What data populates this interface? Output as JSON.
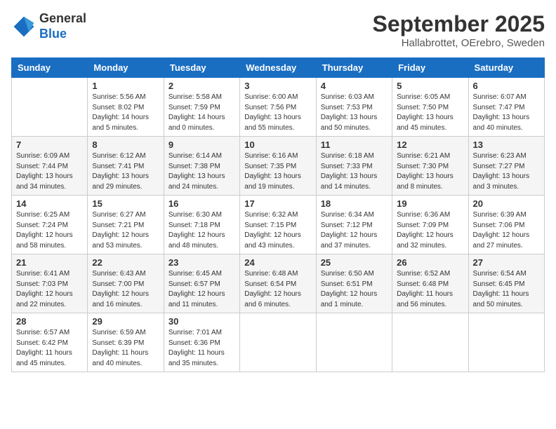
{
  "logo": {
    "general": "General",
    "blue": "Blue"
  },
  "title": "September 2025",
  "subtitle": "Hallabrottet, OErebro, Sweden",
  "days_header": [
    "Sunday",
    "Monday",
    "Tuesday",
    "Wednesday",
    "Thursday",
    "Friday",
    "Saturday"
  ],
  "weeks": [
    [
      {
        "day": "",
        "sunrise": "",
        "sunset": "",
        "daylight": ""
      },
      {
        "day": "1",
        "sunrise": "Sunrise: 5:56 AM",
        "sunset": "Sunset: 8:02 PM",
        "daylight": "Daylight: 14 hours and 5 minutes."
      },
      {
        "day": "2",
        "sunrise": "Sunrise: 5:58 AM",
        "sunset": "Sunset: 7:59 PM",
        "daylight": "Daylight: 14 hours and 0 minutes."
      },
      {
        "day": "3",
        "sunrise": "Sunrise: 6:00 AM",
        "sunset": "Sunset: 7:56 PM",
        "daylight": "Daylight: 13 hours and 55 minutes."
      },
      {
        "day": "4",
        "sunrise": "Sunrise: 6:03 AM",
        "sunset": "Sunset: 7:53 PM",
        "daylight": "Daylight: 13 hours and 50 minutes."
      },
      {
        "day": "5",
        "sunrise": "Sunrise: 6:05 AM",
        "sunset": "Sunset: 7:50 PM",
        "daylight": "Daylight: 13 hours and 45 minutes."
      },
      {
        "day": "6",
        "sunrise": "Sunrise: 6:07 AM",
        "sunset": "Sunset: 7:47 PM",
        "daylight": "Daylight: 13 hours and 40 minutes."
      }
    ],
    [
      {
        "day": "7",
        "sunrise": "Sunrise: 6:09 AM",
        "sunset": "Sunset: 7:44 PM",
        "daylight": "Daylight: 13 hours and 34 minutes."
      },
      {
        "day": "8",
        "sunrise": "Sunrise: 6:12 AM",
        "sunset": "Sunset: 7:41 PM",
        "daylight": "Daylight: 13 hours and 29 minutes."
      },
      {
        "day": "9",
        "sunrise": "Sunrise: 6:14 AM",
        "sunset": "Sunset: 7:38 PM",
        "daylight": "Daylight: 13 hours and 24 minutes."
      },
      {
        "day": "10",
        "sunrise": "Sunrise: 6:16 AM",
        "sunset": "Sunset: 7:35 PM",
        "daylight": "Daylight: 13 hours and 19 minutes."
      },
      {
        "day": "11",
        "sunrise": "Sunrise: 6:18 AM",
        "sunset": "Sunset: 7:33 PM",
        "daylight": "Daylight: 13 hours and 14 minutes."
      },
      {
        "day": "12",
        "sunrise": "Sunrise: 6:21 AM",
        "sunset": "Sunset: 7:30 PM",
        "daylight": "Daylight: 13 hours and 8 minutes."
      },
      {
        "day": "13",
        "sunrise": "Sunrise: 6:23 AM",
        "sunset": "Sunset: 7:27 PM",
        "daylight": "Daylight: 13 hours and 3 minutes."
      }
    ],
    [
      {
        "day": "14",
        "sunrise": "Sunrise: 6:25 AM",
        "sunset": "Sunset: 7:24 PM",
        "daylight": "Daylight: 12 hours and 58 minutes."
      },
      {
        "day": "15",
        "sunrise": "Sunrise: 6:27 AM",
        "sunset": "Sunset: 7:21 PM",
        "daylight": "Daylight: 12 hours and 53 minutes."
      },
      {
        "day": "16",
        "sunrise": "Sunrise: 6:30 AM",
        "sunset": "Sunset: 7:18 PM",
        "daylight": "Daylight: 12 hours and 48 minutes."
      },
      {
        "day": "17",
        "sunrise": "Sunrise: 6:32 AM",
        "sunset": "Sunset: 7:15 PM",
        "daylight": "Daylight: 12 hours and 43 minutes."
      },
      {
        "day": "18",
        "sunrise": "Sunrise: 6:34 AM",
        "sunset": "Sunset: 7:12 PM",
        "daylight": "Daylight: 12 hours and 37 minutes."
      },
      {
        "day": "19",
        "sunrise": "Sunrise: 6:36 AM",
        "sunset": "Sunset: 7:09 PM",
        "daylight": "Daylight: 12 hours and 32 minutes."
      },
      {
        "day": "20",
        "sunrise": "Sunrise: 6:39 AM",
        "sunset": "Sunset: 7:06 PM",
        "daylight": "Daylight: 12 hours and 27 minutes."
      }
    ],
    [
      {
        "day": "21",
        "sunrise": "Sunrise: 6:41 AM",
        "sunset": "Sunset: 7:03 PM",
        "daylight": "Daylight: 12 hours and 22 minutes."
      },
      {
        "day": "22",
        "sunrise": "Sunrise: 6:43 AM",
        "sunset": "Sunset: 7:00 PM",
        "daylight": "Daylight: 12 hours and 16 minutes."
      },
      {
        "day": "23",
        "sunrise": "Sunrise: 6:45 AM",
        "sunset": "Sunset: 6:57 PM",
        "daylight": "Daylight: 12 hours and 11 minutes."
      },
      {
        "day": "24",
        "sunrise": "Sunrise: 6:48 AM",
        "sunset": "Sunset: 6:54 PM",
        "daylight": "Daylight: 12 hours and 6 minutes."
      },
      {
        "day": "25",
        "sunrise": "Sunrise: 6:50 AM",
        "sunset": "Sunset: 6:51 PM",
        "daylight": "Daylight: 12 hours and 1 minute."
      },
      {
        "day": "26",
        "sunrise": "Sunrise: 6:52 AM",
        "sunset": "Sunset: 6:48 PM",
        "daylight": "Daylight: 11 hours and 56 minutes."
      },
      {
        "day": "27",
        "sunrise": "Sunrise: 6:54 AM",
        "sunset": "Sunset: 6:45 PM",
        "daylight": "Daylight: 11 hours and 50 minutes."
      }
    ],
    [
      {
        "day": "28",
        "sunrise": "Sunrise: 6:57 AM",
        "sunset": "Sunset: 6:42 PM",
        "daylight": "Daylight: 11 hours and 45 minutes."
      },
      {
        "day": "29",
        "sunrise": "Sunrise: 6:59 AM",
        "sunset": "Sunset: 6:39 PM",
        "daylight": "Daylight: 11 hours and 40 minutes."
      },
      {
        "day": "30",
        "sunrise": "Sunrise: 7:01 AM",
        "sunset": "Sunset: 6:36 PM",
        "daylight": "Daylight: 11 hours and 35 minutes."
      },
      {
        "day": "",
        "sunrise": "",
        "sunset": "",
        "daylight": ""
      },
      {
        "day": "",
        "sunrise": "",
        "sunset": "",
        "daylight": ""
      },
      {
        "day": "",
        "sunrise": "",
        "sunset": "",
        "daylight": ""
      },
      {
        "day": "",
        "sunrise": "",
        "sunset": "",
        "daylight": ""
      }
    ]
  ]
}
